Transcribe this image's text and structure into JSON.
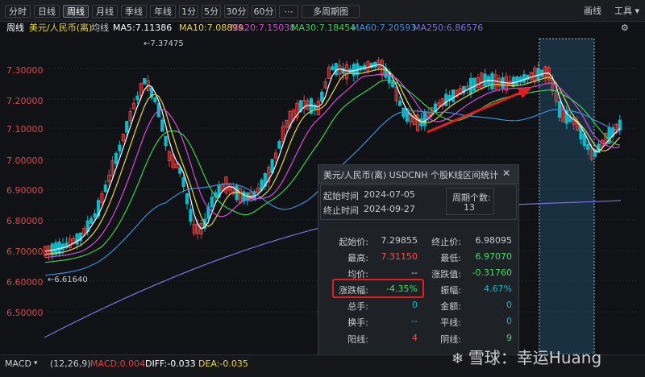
{
  "toolbar": {
    "periods": [
      "分时",
      "日线",
      "周线",
      "月线",
      "季线",
      "年线",
      "1分",
      "5分",
      "30分",
      "60分",
      "多周期图"
    ],
    "active": "周线",
    "draw_label": "画线",
    "tools_label": "工具"
  },
  "infobar": {
    "period": "周线",
    "symbol": "美元/人民币(离)",
    "ma_mode": "均线",
    "ma5": "MA5:7.11386",
    "ma10": "MA10:7.08899",
    "ma20": "MA20:7.15038",
    "ma30": "MA30:7.18454",
    "ma60": "MA60:7.20593",
    "ma250": "MA250:6.86576"
  },
  "chart": {
    "y_ticks": [
      "7.30000",
      "7.20000",
      "7.10000",
      "7.00000",
      "6.90000",
      "6.80000",
      "6.70000",
      "6.60000",
      "6.50000"
    ],
    "high_label": "7.37475",
    "low_label": "6.61640",
    "colors": {
      "up": "#e04141",
      "down": "#10b8c8",
      "ma5": "#ffffff",
      "ma10": "#e8d44a",
      "ma20": "#d84bd8",
      "ma30": "#3ecf52",
      "ma60": "#3a8fdc",
      "ma250": "#7d6fe0"
    }
  },
  "popup": {
    "title": "美元/人民币(离)  USDCNH  个股K线区间统计",
    "start_label": "起始时间",
    "start_value": "2024-07-05",
    "end_label": "终止时间",
    "end_value": "2024-09-27",
    "count_label": "周期个数:",
    "count_value": "13",
    "rows": [
      {
        "l1": "起始价:",
        "v1": "7.29855",
        "l2": "终止价:",
        "v2": "6.98095"
      },
      {
        "l1": "最高:",
        "v1": "7.31150",
        "l2": "最低:",
        "v2": "6.97070"
      },
      {
        "l1": "均价:",
        "v1": "--",
        "l2": "涨跌值:",
        "v2": "-0.31760"
      },
      {
        "l1": "涨跌幅:",
        "v1": "-4.35%",
        "l2": "振幅:",
        "v2": "4.67%"
      },
      {
        "l1": "总手:",
        "v1": "0",
        "l2": "金额:",
        "v2": "0"
      },
      {
        "l1": "换手:",
        "v1": "--",
        "l2": "平线:",
        "v2": "0"
      },
      {
        "l1": "阳线:",
        "v1": "4",
        "l2": "阴线:",
        "v2": "9"
      }
    ]
  },
  "bottom": {
    "indicator": "MACD",
    "params": "(12,26,9)",
    "macd": "MACD:0.004",
    "diff": "DIFF:-0.033",
    "dea": "DEA:-0.035"
  },
  "watermark": "雪球：幸运Huang"
}
